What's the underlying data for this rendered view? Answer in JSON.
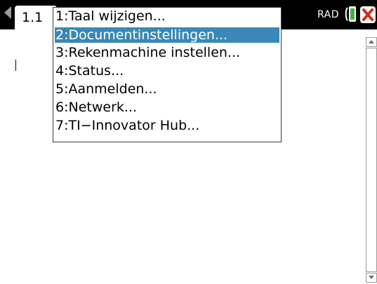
{
  "statusbar": {
    "page_tab": "1.1",
    "mode": "RAD"
  },
  "menu": {
    "selected_index": 1,
    "items": [
      {
        "label": "1:Taal wijzigen..."
      },
      {
        "label": "2:Documentinstellingen..."
      },
      {
        "label": "3:Rekenmachine instellen..."
      },
      {
        "label": "4:Status..."
      },
      {
        "label": "5:Aanmelden..."
      },
      {
        "label": "6:Netwerk..."
      },
      {
        "label": "7:TI−Innovator Hub..."
      }
    ]
  },
  "colors": {
    "selection": "#3a88b6",
    "close_icon": "#d9261c",
    "battery": "#3db43d"
  }
}
